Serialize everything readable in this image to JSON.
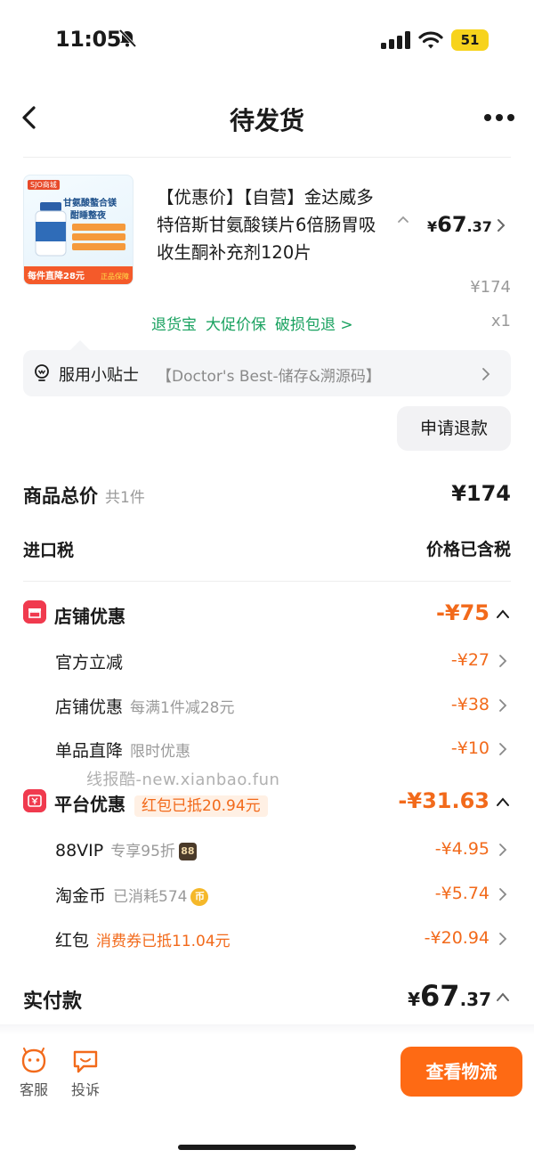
{
  "status_bar": {
    "time": "11:05",
    "battery": "51"
  },
  "header": {
    "title": "待发货"
  },
  "product": {
    "image_text": {
      "brand": "SJO商城",
      "name_line1": "甘氨酸螯合镁",
      "name_line2": "酣睡整夜",
      "promo": "每件直降28元",
      "badge": "正品保障"
    },
    "title": "【优惠价】【自营】金达威多特倍斯甘氨酸镁片6倍肠胃吸收生酮补充剂120片",
    "price_symbol": "¥",
    "price_int": "67",
    "price_dec": ".37",
    "original_price": "¥174",
    "services": [
      "退货宝",
      "大促价保",
      "破损包退 >"
    ],
    "quantity": "x1"
  },
  "tips": {
    "label": "服用小贴士",
    "info": "【Doctor's Best-储存&溯源码】"
  },
  "refund_button": "申请退款",
  "totals": {
    "label": "商品总价",
    "count": "共1件",
    "value": "¥174",
    "tax_label": "进口税",
    "tax_value": "价格已含税"
  },
  "store_discount": {
    "label": "店铺优惠",
    "value": "-¥75",
    "items": [
      {
        "label": "官方立减",
        "sub": "",
        "value": "-¥27"
      },
      {
        "label": "店铺优惠",
        "sub": "每满1件减28元",
        "value": "-¥38"
      },
      {
        "label": "单品直降",
        "sub": "限时优惠",
        "value": "-¥10"
      }
    ]
  },
  "watermark": "线报酷-new.xianbao.fun",
  "platform_discount": {
    "label": "平台优惠",
    "tag": "红包已抵20.94元",
    "value": "-¥31.63",
    "items": [
      {
        "label": "88VIP",
        "sub": "专享95折",
        "badge": "88",
        "value": "-¥4.95"
      },
      {
        "label": "淘金币",
        "sub": "已消耗574",
        "badge": "币",
        "value": "-¥5.74"
      },
      {
        "label": "红包",
        "sub": "消费券已抵11.04元",
        "value": "-¥20.94"
      }
    ]
  },
  "paid": {
    "label": "实付款",
    "symbol": "¥",
    "int": "67",
    "dec": ".37"
  },
  "footer": {
    "service_label": "客服",
    "complaint_label": "投诉",
    "track_button": "查看物流"
  },
  "colors": {
    "accent": "#fe6a14",
    "discount": "#f26a1b",
    "service_green": "#1aa260",
    "store_red": "#f03a4e"
  }
}
